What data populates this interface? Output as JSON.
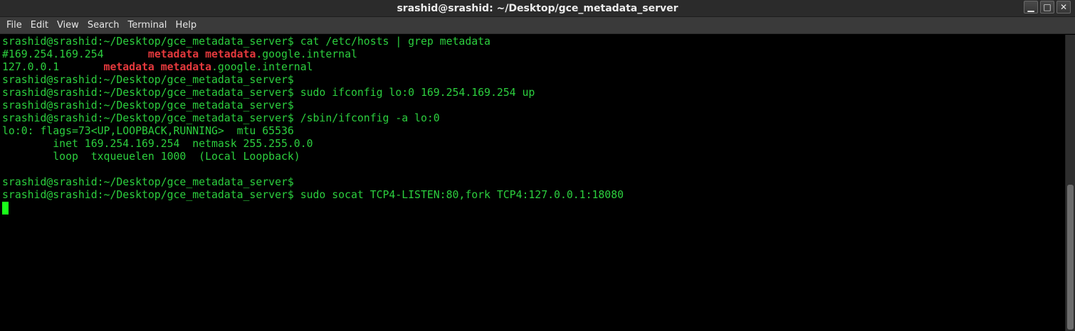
{
  "window": {
    "title": "srashid@srashid: ~/Desktop/gce_metadata_server",
    "minimize_glyph": "▁",
    "maximize_glyph": "□",
    "close_glyph": "✕"
  },
  "menu": {
    "file": "File",
    "edit": "Edit",
    "view": "View",
    "search": "Search",
    "terminal": "Terminal",
    "help": "Help"
  },
  "terminal": {
    "lines": [
      [
        "srashid@srashid:~/Desktop/gce_metadata_server$ cat /etc/hosts | grep metadata"
      ],
      [
        "#169.254.169.254       ",
        {
          "hl": "metadata metadata"
        },
        ".google.internal"
      ],
      [
        "127.0.0.1       ",
        {
          "hl": "metadata metadata"
        },
        ".google.internal"
      ],
      [
        "srashid@srashid:~/Desktop/gce_metadata_server$"
      ],
      [
        "srashid@srashid:~/Desktop/gce_metadata_server$ sudo ifconfig lo:0 169.254.169.254 up"
      ],
      [
        "srashid@srashid:~/Desktop/gce_metadata_server$"
      ],
      [
        "srashid@srashid:~/Desktop/gce_metadata_server$ /sbin/ifconfig -a lo:0"
      ],
      [
        "lo:0: flags=73<UP,LOOPBACK,RUNNING>  mtu 65536"
      ],
      [
        "        inet 169.254.169.254  netmask 255.255.0.0"
      ],
      [
        "        loop  txqueuelen 1000  (Local Loopback)"
      ],
      [
        ""
      ],
      [
        "srashid@srashid:~/Desktop/gce_metadata_server$"
      ],
      [
        "srashid@srashid:~/Desktop/gce_metadata_server$ sudo socat TCP4-LISTEN:80,fork TCP4:127.0.0.1:18080"
      ],
      [
        ""
      ]
    ],
    "colors": {
      "text": "#2ccf3e",
      "highlight": "#e5393d",
      "cursor": "#1aff1a",
      "background": "#000000"
    }
  }
}
